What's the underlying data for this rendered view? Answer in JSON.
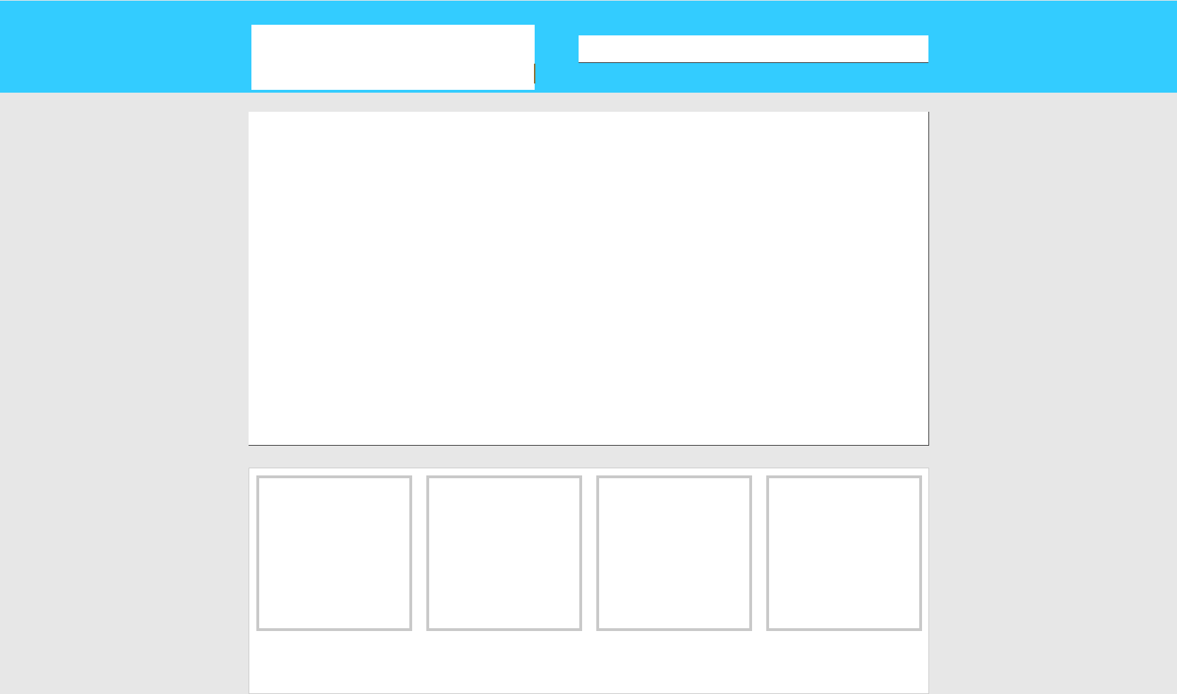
{
  "header": {
    "background_color": "#33ccff",
    "logo": {
      "text": ""
    },
    "search": {
      "value": "",
      "placeholder": ""
    }
  },
  "banner": {
    "text": ""
  },
  "gallery": {
    "thumbnails": [
      {
        "label": ""
      },
      {
        "label": ""
      },
      {
        "label": ""
      },
      {
        "label": ""
      }
    ],
    "credit": ""
  },
  "colors": {
    "page_background": "#e7e7e7",
    "header_background": "#33ccff",
    "panel_background": "#ffffff",
    "thumbnail_border": "#c9c9c9"
  }
}
